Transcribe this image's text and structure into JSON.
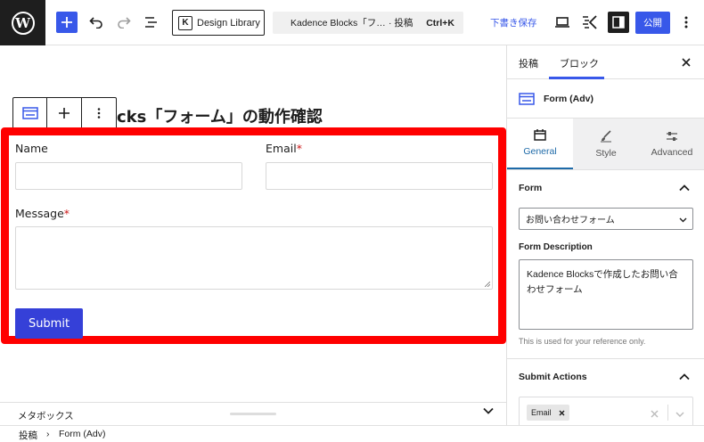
{
  "toolbar": {
    "design_library_label": "Design Library",
    "command_title": "Kadence Blocks「フ…",
    "command_type": "· 投稿",
    "command_shortcut": "Ctrl+K",
    "save_draft_label": "下書き保存",
    "publish_label": "公開"
  },
  "editor": {
    "post_title": "cks「フォーム」の動作確認",
    "form": {
      "name_label": "Name",
      "email_label": "Email",
      "message_label": "Message",
      "required_mark": "*",
      "submit_label": "Submit"
    },
    "metabox_label": "メタボックス"
  },
  "breadcrumb": {
    "items": [
      "投稿",
      "›",
      "Form (Adv)"
    ]
  },
  "sidebar": {
    "tabs": [
      "投稿",
      "ブロック"
    ],
    "active_tab": "ブロック",
    "block_name": "Form (Adv)",
    "inspector_tabs": [
      "General",
      "Style",
      "Advanced"
    ],
    "active_inspector_tab": "General",
    "form_panel_title": "Form",
    "form_select_value": "お問い合わせフォーム",
    "description_label": "Form Description",
    "description_value": "Kadence Blocksで作成したお問い合わせフォーム",
    "description_help": "This is used for your reference only.",
    "submit_actions_title": "Submit Actions",
    "submit_action_chip": "Email"
  },
  "colors": {
    "accent": "#3858e9",
    "highlight_border": "#ff0000",
    "submit_button": "#3540d8",
    "kadence_active": "#1e6aa8"
  }
}
